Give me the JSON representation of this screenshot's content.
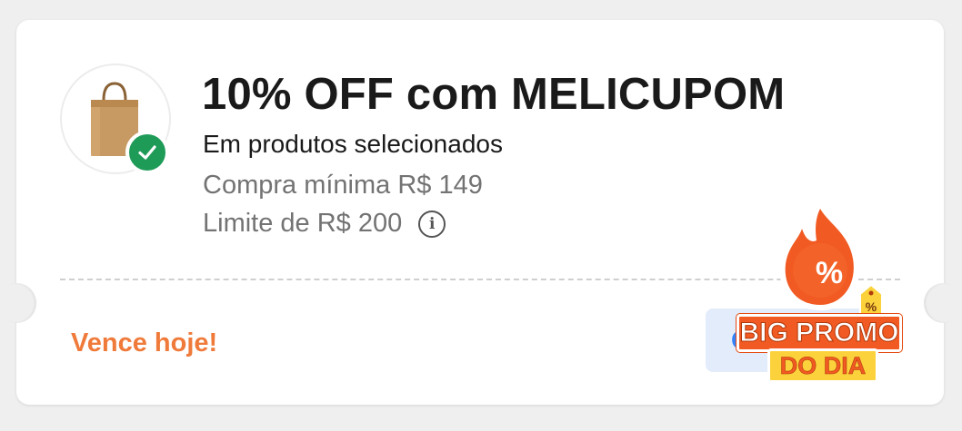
{
  "coupon": {
    "title": "10% OFF com MELICUPOM",
    "subtitle": "Em produtos selecionados",
    "min_purchase": "Compra mínima R$ 149",
    "limit": "Limite de R$ 200",
    "info_symbol": "i",
    "expiry": "Vence hoje!",
    "cta_label": "Ge"
  },
  "badge": {
    "line1": "BIG PROMO",
    "line2": "DO DIA",
    "fire_symbol": "%",
    "tag_symbol": "%"
  },
  "icons": {
    "product": "shopping-bag-icon",
    "applied": "check-icon",
    "info": "info-icon",
    "badge": "fire-percent-icon"
  },
  "colors": {
    "accent_orange": "#ef7a3a",
    "check_green": "#1f9b58",
    "cta_blue": "#3483fa",
    "cta_bg": "#e3ecfb",
    "badge_orange": "#f15a22",
    "badge_yellow": "#fbd23b"
  }
}
